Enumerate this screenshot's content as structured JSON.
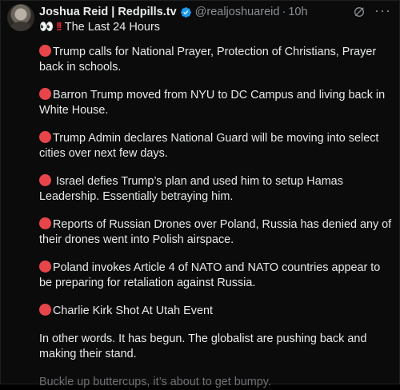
{
  "post": {
    "author": {
      "display_name": "Joshua Reid | Redpills.tv",
      "handle": "@realjoshuareid",
      "separator": "·",
      "time": "10h",
      "verified_color": "#1d9bf0"
    },
    "subtitle": {
      "emoji": "👀",
      "exclaim": "!!",
      "text": "The Last 24 Hours"
    },
    "items": [
      "Trump calls for National Prayer, Protection of Christians, Prayer back in schools.",
      "Barron Trump moved from NYU to DC Campus and living back in White House.",
      "Trump Admin declares National Guard will be moving into select cities over next few days.",
      " Israel defies Trump’s plan and used him to setup Hamas Leadership. Essentially betraying him.",
      "Reports of Russian Drones over Poland, Russia has denied any of their drones went into Polish airspace.",
      "Poland invokes Article 4 of NATO and NATO countries appear to be preparing for retaliation against Russia.",
      "Charlie Kirk Shot At Utah Event"
    ],
    "outro": "In other words. It has begun. The globalist are pushing back and making their stand.",
    "closing": "Buckle up buttercups, it’s about to get bumpy.",
    "bullet_color": "#e8454a",
    "icons": {
      "verified": "verified-badge-icon",
      "grok": "grok-icon",
      "more": "more-options-icon",
      "bullet": "red-circle-icon"
    }
  }
}
